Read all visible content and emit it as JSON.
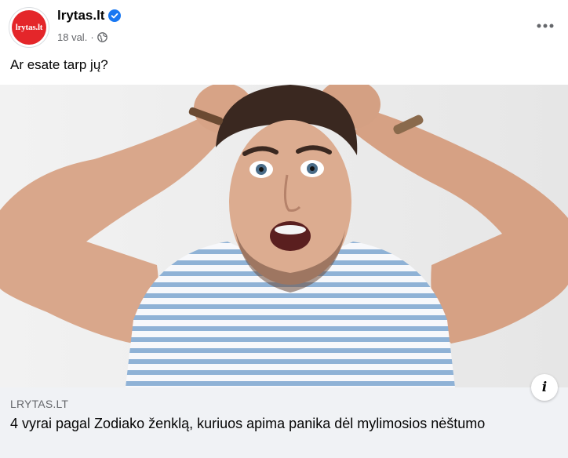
{
  "post": {
    "page_name": "lrytas.lt",
    "avatar_text": "lrytas.lt",
    "timestamp": "18 val.",
    "separator": "·",
    "privacy_icon": "globe-icon",
    "verified_icon": "verified-badge-icon",
    "more_icon": "more-options-icon",
    "text": "Ar esate tarp jų?"
  },
  "link_preview": {
    "domain": "LRYTAS.LT",
    "title": "4 vyrai pagal Zodiako ženklą, kuriuos apima panika dėl mylimosios nėštumo",
    "info_icon": "info-icon",
    "info_glyph": "i"
  },
  "colors": {
    "brand_red": "#e4262a",
    "verified_blue": "#1877f2",
    "secondary_text": "#65676b",
    "preview_bg": "#f0f2f5"
  }
}
